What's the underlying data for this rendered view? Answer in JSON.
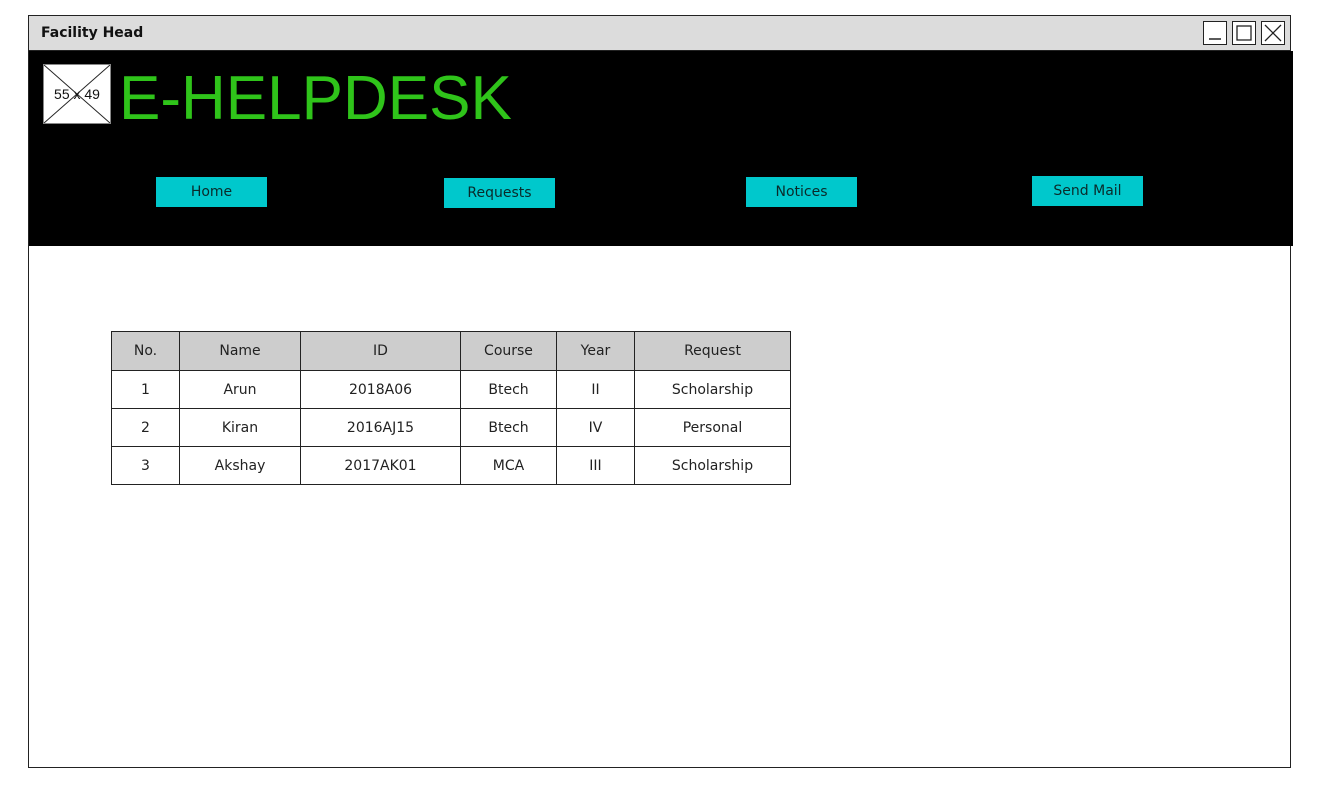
{
  "window": {
    "title": "Facility Head"
  },
  "logo": {
    "placeholder_label": "55 x 49"
  },
  "brand": {
    "name": "E-HELPDESK",
    "color": "#2fc41a"
  },
  "nav": {
    "accent": "#00c8cc",
    "items": [
      {
        "label": "Home"
      },
      {
        "label": "Requests"
      },
      {
        "label": "Notices"
      },
      {
        "label": "Send Mail"
      }
    ]
  },
  "table": {
    "headers": [
      "No.",
      "Name",
      "ID",
      "Course",
      "Year",
      "Request"
    ],
    "rows": [
      [
        "1",
        "Arun",
        "2018A06",
        "Btech",
        "II",
        "Scholarship"
      ],
      [
        "2",
        "Kiran",
        "2016AJ15",
        "Btech",
        "IV",
        "Personal"
      ],
      [
        "3",
        "Akshay",
        "2017AK01",
        "MCA",
        "III",
        "Scholarship"
      ]
    ]
  }
}
